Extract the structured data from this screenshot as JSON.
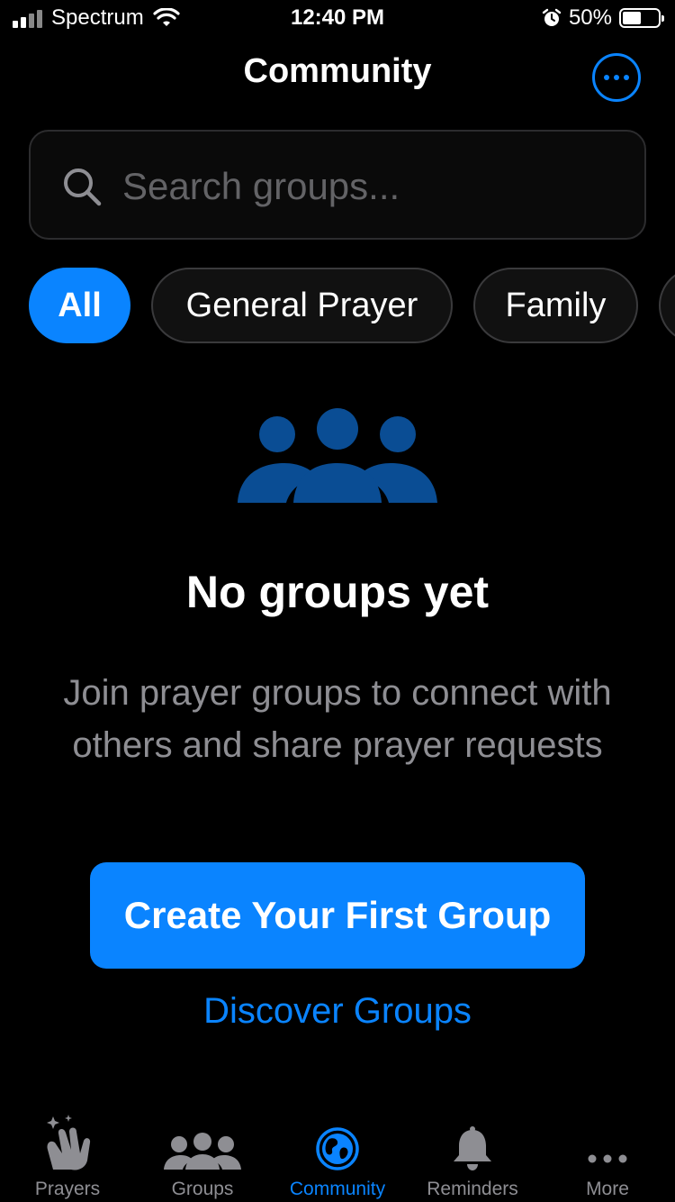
{
  "status_bar": {
    "carrier": "Spectrum",
    "time": "12:40 PM",
    "battery": "50%",
    "battery_level": 0.5
  },
  "header": {
    "title": "Community",
    "more_icon": "ellipsis-circle-icon"
  },
  "search": {
    "placeholder": "Search groups...",
    "value": ""
  },
  "filters": {
    "chips": [
      "All",
      "General Prayer",
      "Family"
    ],
    "selected": "All"
  },
  "empty_state": {
    "icon": "people-group-icon",
    "title": "No groups yet",
    "description": "Join prayer groups to connect with others and share prayer requests",
    "primary_action": "Create Your First Group",
    "secondary_action": "Discover Groups"
  },
  "tabbar": {
    "items": [
      {
        "label": "Prayers",
        "icon": "praying-hands-icon"
      },
      {
        "label": "Groups",
        "icon": "people-icon"
      },
      {
        "label": "Community",
        "icon": "globe-icon"
      },
      {
        "label": "Reminders",
        "icon": "bell-icon"
      },
      {
        "label": "More",
        "icon": "ellipsis-icon"
      }
    ],
    "active": "Community"
  },
  "colors": {
    "accent": "#0a84ff",
    "background": "#000000",
    "muted_text": "#8e8e93",
    "icon_dark_blue": "#0a4d94"
  }
}
